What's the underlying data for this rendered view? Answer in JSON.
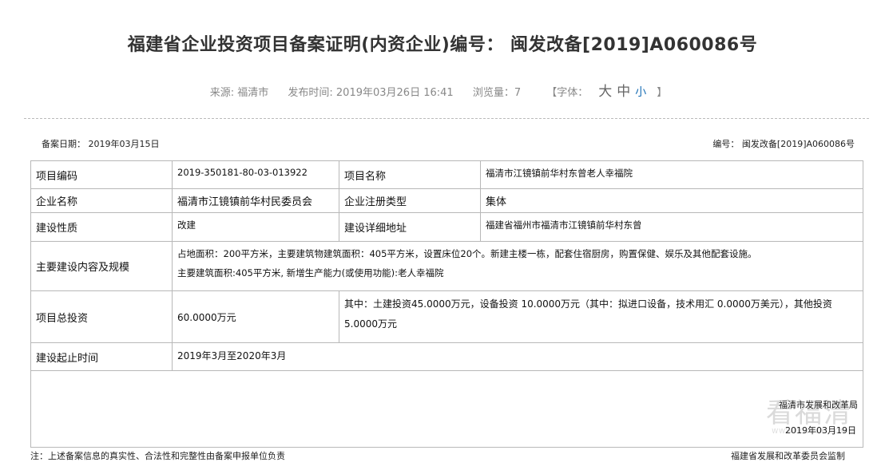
{
  "header": {
    "title": "福建省企业投资项目备案证明(内资企业)编号： 闽发改备[2019]A060086号",
    "source": "来源: 福清市",
    "publish_time": "发布时间: 2019年03月26日 16:41",
    "views": "浏览量：7",
    "font_label": "【字体：",
    "font_large": "大",
    "font_medium": "中",
    "font_small": "小",
    "font_close": "】"
  },
  "record": {
    "date": "备案日期： 2019年03月15日",
    "number": "编号： 闽发改备[2019]A060086号"
  },
  "table": {
    "project_code_label": "项目编码",
    "project_code": "2019-350181-80-03-013922",
    "project_name_label": "项目名称",
    "project_name": "福清市江镜镇前华村东曾老人幸福院",
    "enterprise_label": "企业名称",
    "enterprise": "福清市江镜镇前华村民委员会",
    "reg_type_label": "企业注册类型",
    "reg_type": "集体",
    "nature_label": "建设性质",
    "nature": "改建",
    "address_label": "建设详细地址",
    "address": "福建省福州市福清市江镜镇前华村东曾",
    "content_label": "主要建设内容及规模",
    "content_line1": "占地面积：200平方米，主要建筑物建筑面积：405平方米，设置床位20个。新建主楼一栋，配套住宿厨房，购置保健、娱乐及其他配套设施。",
    "content_line2": "主要建筑面积:405平方米, 新增生产能力(或使用功能):老人幸福院",
    "investment_label": "项目总投资",
    "investment": "60.0000万元",
    "investment_detail_line1": "其中：土建投资45.0000万元，设备投资 10.0000万元（其中：拟进口设备，技术用汇 0.0000万美元），其他投资",
    "investment_detail_line2": "5.0000万元",
    "period_label": "建设起止时间",
    "period": "2019年3月至2020年3月",
    "org": "福清市发展和改革局",
    "sign_date": "2019年03月19日"
  },
  "footer": {
    "note": "注：上述备案信息的真实性、合法性和完整性由备案申报单位负责",
    "supervise": "福建省发展和改革委员会监制"
  },
  "watermark": {
    "big": "看福清",
    "small": "WWW.FQLOOK.COM"
  }
}
